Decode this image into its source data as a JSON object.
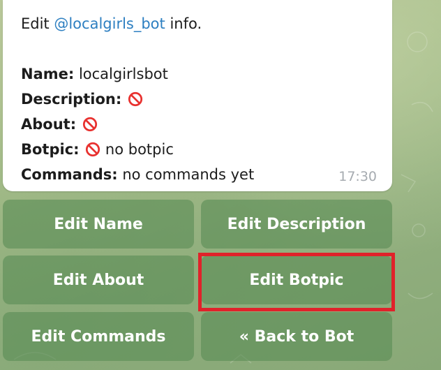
{
  "message": {
    "intro_prefix": "Edit ",
    "intro_mention": "@localgirls_bot",
    "intro_suffix": " info.",
    "fields": [
      {
        "label": "Name:",
        "value": " localgirlsbot",
        "icon": null
      },
      {
        "label": "Description:",
        "value": "",
        "icon": "no-entry-icon"
      },
      {
        "label": "About:",
        "value": "",
        "icon": "no-entry-icon"
      },
      {
        "label": "Botpic:",
        "value": " no botpic",
        "icon": "no-entry-icon"
      },
      {
        "label": "Commands:",
        "value": " no commands yet",
        "icon": null
      }
    ],
    "time": "17:30"
  },
  "keyboard": {
    "edit_name": "Edit Name",
    "edit_description": "Edit Description",
    "edit_about": "Edit About",
    "edit_botpic": "Edit Botpic",
    "edit_commands": "Edit Commands",
    "back_to_bot": "« Back to Bot"
  },
  "colors": {
    "mention": "#2d7fc1",
    "button_bg": "rgba(90,140,85,0.62)",
    "highlight": "#e0222a",
    "no_entry": "#e8312f"
  }
}
